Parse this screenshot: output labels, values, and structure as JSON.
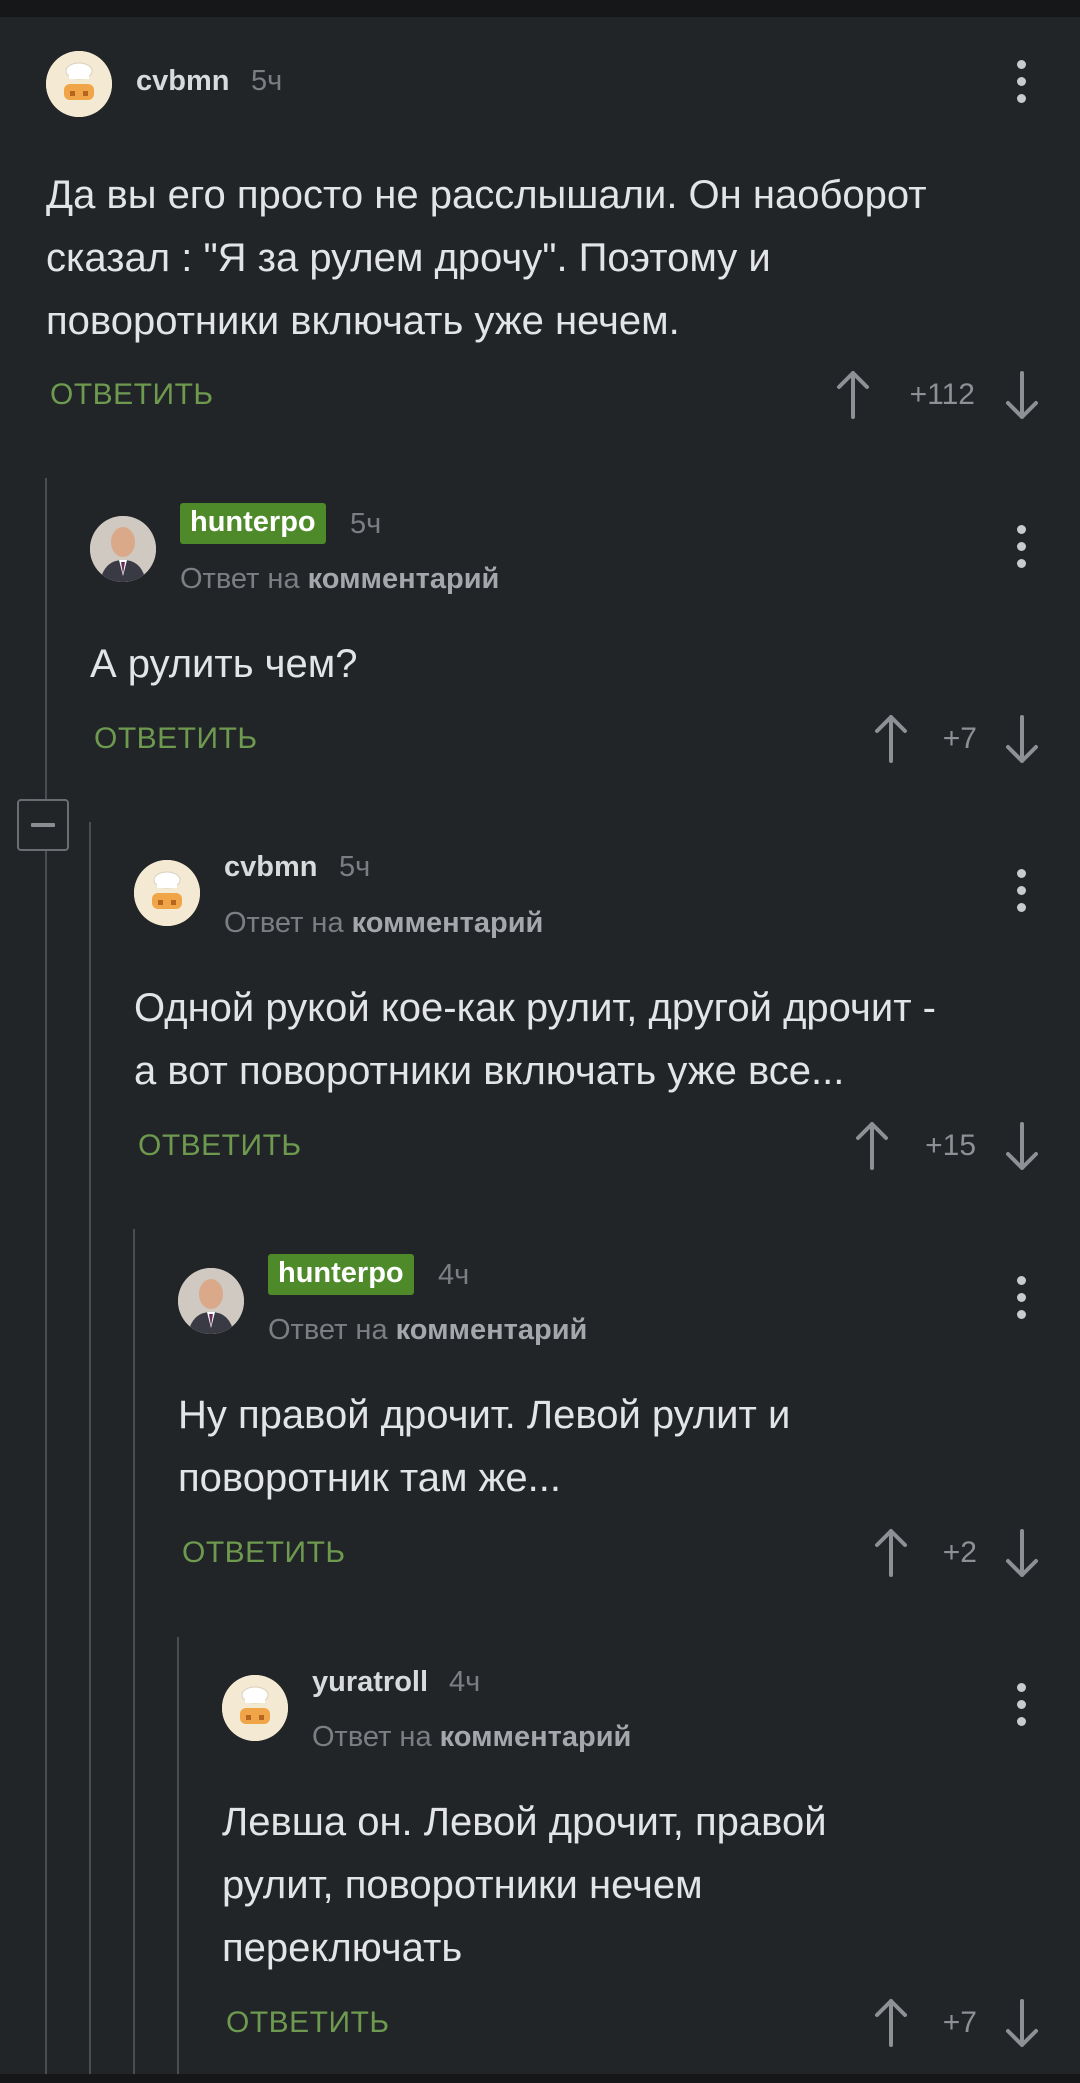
{
  "reply_label": "ОТВЕТИТЬ",
  "reply_to_prefix": "Ответ на",
  "reply_to_link": "комментарий",
  "comments": [
    {
      "author": "cvbmn",
      "time": "5ч",
      "text": [
        "Да вы его просто не расслышали. Он наоборот",
        "сказал : \"Я за рулем дрочу\". Поэтому и",
        "поворотники включать уже нечем."
      ],
      "score": "+112",
      "badge": false,
      "avatar": "chef-avatar"
    },
    {
      "author": "hunterpo",
      "time": "5ч",
      "text": [
        "А рулить чем?"
      ],
      "score": "+7",
      "badge": true,
      "avatar": "person-avatar"
    },
    {
      "author": "cvbmn",
      "time": "5ч",
      "text": [
        "Одной рукой кое-как рулит, другой дрочит -",
        "а вот поворотники включать уже все..."
      ],
      "score": "+15",
      "badge": false,
      "avatar": "chef-avatar"
    },
    {
      "author": "hunterpo",
      "time": "4ч",
      "text": [
        "Ну правой дрочит. Левой рулит и",
        "поворотник там же..."
      ],
      "score": "+2",
      "badge": true,
      "avatar": "person-avatar"
    },
    {
      "author": "yuratroll",
      "time": "4ч",
      "text": [
        "Левша он. Левой дрочит, правой",
        "рулит, поворотники нечем",
        "переключать"
      ],
      "score": "+7",
      "badge": false,
      "avatar": "chef-avatar"
    }
  ],
  "colors": {
    "background": "#222528",
    "reply_green": "#6e9a4f",
    "badge_green": "#4e8a2a",
    "muted": "#7b7e82"
  },
  "icons": {
    "menu": "vertical-dots-icon",
    "upvote": "arrow-up-icon",
    "downvote": "arrow-down-icon",
    "collapse": "minus-square-icon"
  }
}
